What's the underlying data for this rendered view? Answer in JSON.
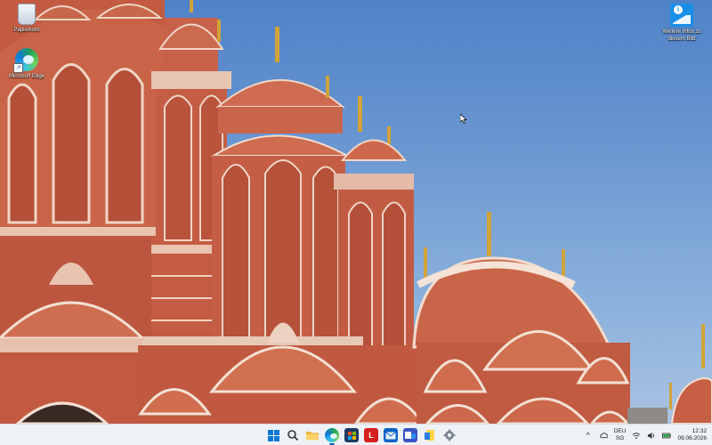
{
  "desktop": {
    "icons": [
      {
        "label": "Papierkorb",
        "icon": "recycle-bin-icon"
      },
      {
        "label": "Microsoft Edge",
        "icon": "edge-icon"
      },
      {
        "label": "Weitere Infos zu diesem Bild",
        "icon": "info-picture-icon"
      }
    ],
    "wallpaper": "hawa-mahal-palace-facade"
  },
  "taskbar": {
    "apps": [
      {
        "name": "start",
        "icon": "windows-start-icon"
      },
      {
        "name": "search",
        "icon": "search-icon"
      },
      {
        "name": "file-explorer",
        "icon": "folder-icon"
      },
      {
        "name": "edge",
        "icon": "edge-icon",
        "active": true
      },
      {
        "name": "store",
        "icon": "store-icon"
      },
      {
        "name": "app-l",
        "icon": "red-l-icon",
        "glyph": "L"
      },
      {
        "name": "outlook",
        "icon": "mail-icon"
      },
      {
        "name": "teams",
        "icon": "teams-icon"
      },
      {
        "name": "sticky",
        "icon": "notes-icon"
      },
      {
        "name": "settings",
        "icon": "gear-icon"
      }
    ],
    "tray": {
      "overflow_glyph": "^",
      "lang_line1": "DEU",
      "lang_line2": "SG",
      "time": "12:32",
      "date": "09.06.2026"
    }
  },
  "colors": {
    "sky": "#5d8ccd",
    "sandstone": "#c0573f",
    "taskbar": "#eef2f7",
    "accent": "#0067c0"
  }
}
